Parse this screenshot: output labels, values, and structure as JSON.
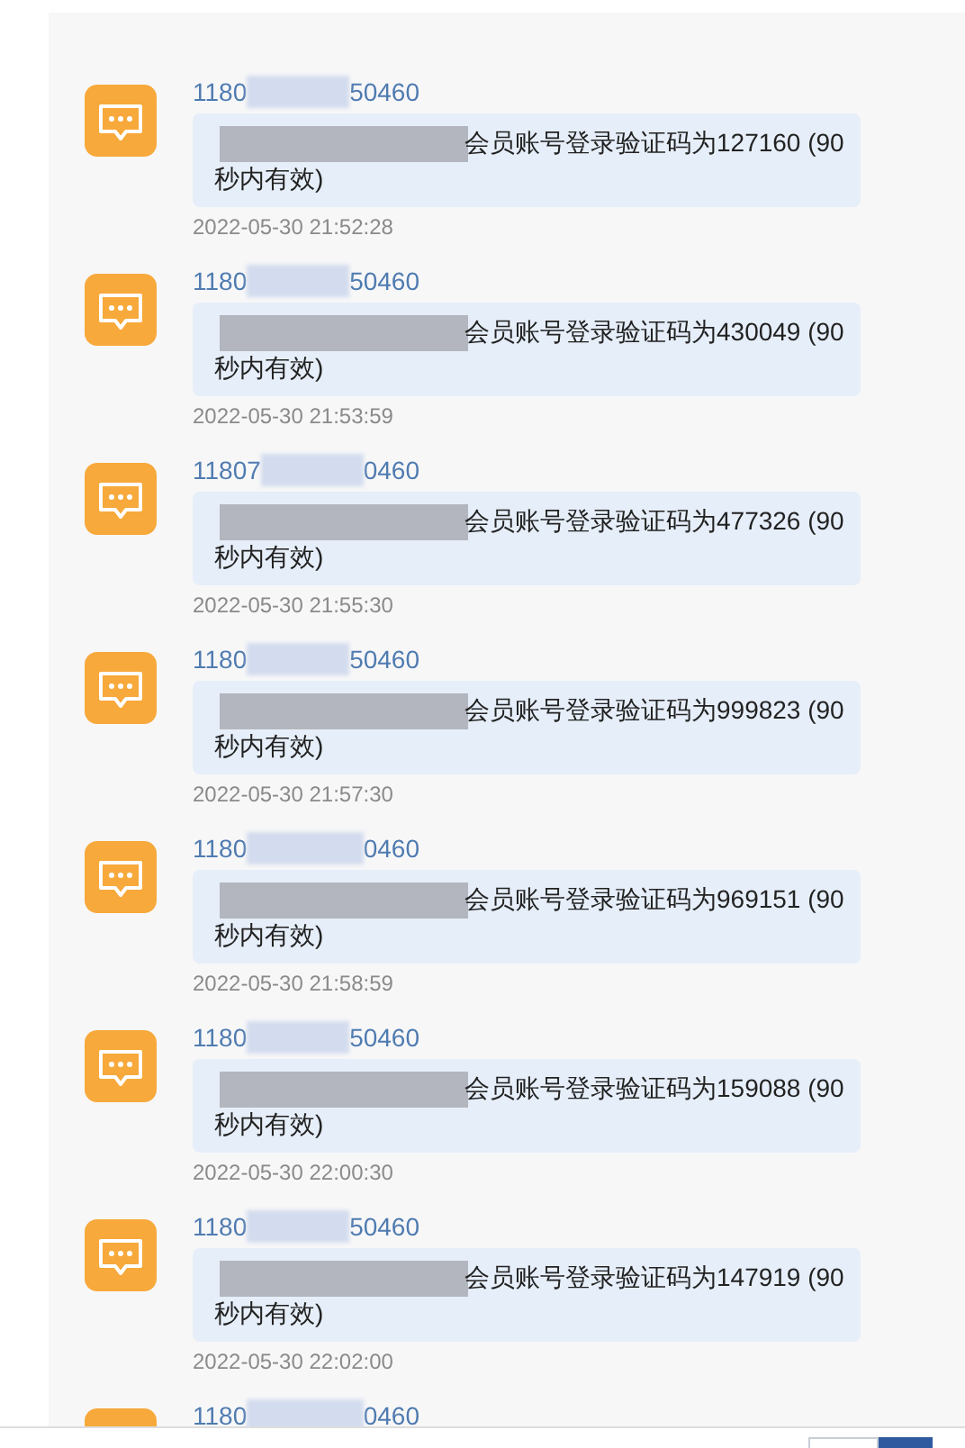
{
  "messages": [
    {
      "sender_start": "1180",
      "sender_end": "50460",
      "text": "会员账号登录验证码为127160 (90秒内有效)",
      "time": "2022-05-30 21:52:28"
    },
    {
      "sender_start": "1180",
      "sender_end": "50460",
      "text": "会员账号登录验证码为430049 (90秒内有效)",
      "time": "2022-05-30 21:53:59"
    },
    {
      "sender_start": "11807",
      "sender_end": "0460",
      "text": "会员账号登录验证码为477326 (90秒内有效)",
      "time": "2022-05-30 21:55:30"
    },
    {
      "sender_start": "1180",
      "sender_end": "50460",
      "text": "会员账号登录验证码为999823 (90秒内有效)",
      "time": "2022-05-30 21:57:30"
    },
    {
      "sender_start": "1180",
      "sender_end": "0460",
      "text": "会员账号登录验证码为969151 (90秒内有效)",
      "time": "2022-05-30 21:58:59"
    },
    {
      "sender_start": "1180",
      "sender_end": "50460",
      "text": "会员账号登录验证码为159088 (90秒内有效)",
      "time": "2022-05-30 22:00:30"
    },
    {
      "sender_start": "1180",
      "sender_end": "50460",
      "text": "会员账号登录验证码为147919 (90秒内有效)",
      "time": "2022-05-30 22:02:00"
    },
    {
      "sender_start": "1180",
      "sender_end": "0460"
    }
  ]
}
